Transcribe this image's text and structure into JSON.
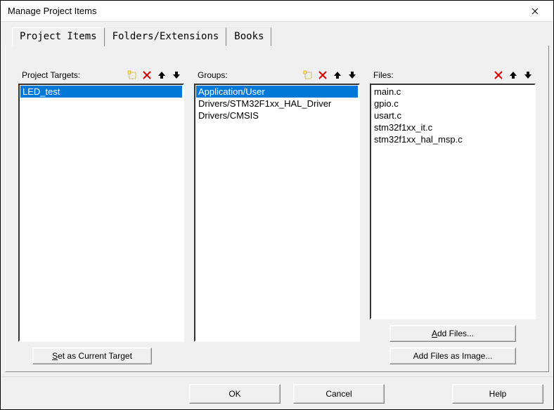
{
  "window": {
    "title": "Manage Project Items"
  },
  "tabs": {
    "items": [
      "Project Items",
      "Folders/Extensions",
      "Books"
    ],
    "activeIndex": 0
  },
  "targets": {
    "label": "Project Targets:",
    "icons": {
      "new": true,
      "delete": true,
      "up": true,
      "down": true
    },
    "items": [
      "LED_test"
    ],
    "selectedIndex": 0
  },
  "groups": {
    "label": "Groups:",
    "icons": {
      "new": true,
      "delete": true,
      "up": true,
      "down": true
    },
    "items": [
      "Application/User",
      "Drivers/STM32F1xx_HAL_Driver",
      "Drivers/CMSIS"
    ],
    "selectedIndex": 0
  },
  "files": {
    "label": "Files:",
    "icons": {
      "new": false,
      "delete": true,
      "up": true,
      "down": true
    },
    "items": [
      "main.c",
      "gpio.c",
      "usart.c",
      "stm32f1xx_it.c",
      "stm32f1xx_hal_msp.c"
    ],
    "selectedIndex": -1
  },
  "buttons": {
    "set_current_target": "Set as Current Target",
    "add_files": "Add Files...",
    "add_files_image": "Add Files as Image...",
    "ok": "OK",
    "cancel": "Cancel",
    "help": "Help"
  },
  "accel": {
    "set_current_target": "S",
    "add_files": "A"
  }
}
